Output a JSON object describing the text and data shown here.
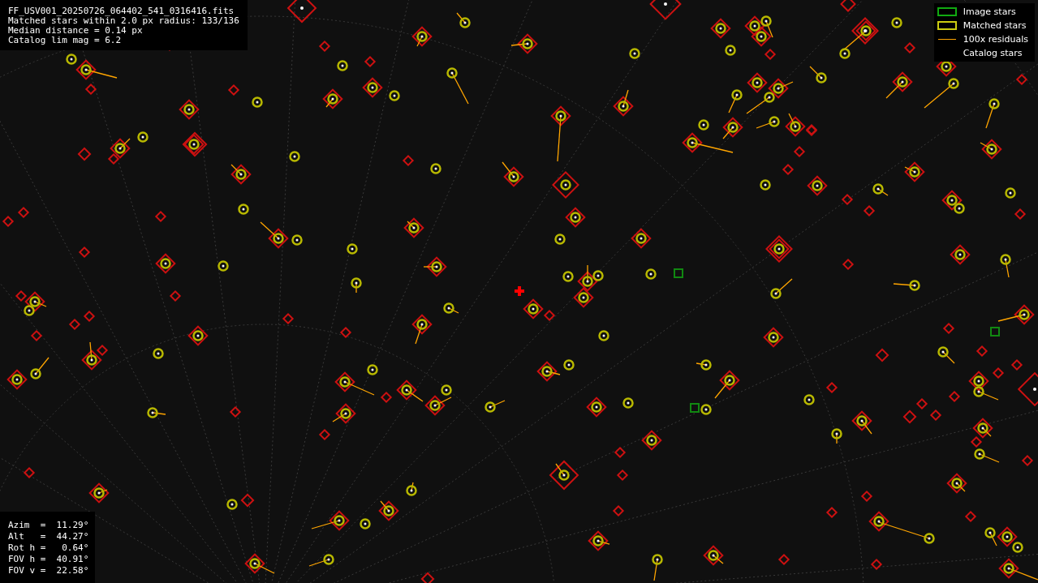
{
  "header": {
    "lines": [
      "FF_USV001_20250726_064402_541_0316416.fits",
      "Matched stars within 2.0 px radius: 133/136",
      "Median distance = 0.14 px",
      "Catalog lim mag = 6.2"
    ]
  },
  "legend": {
    "items": [
      {
        "kind": "box",
        "color": "#11aa11",
        "label": "Image stars"
      },
      {
        "kind": "box",
        "color": "#cccc11",
        "label": "Matched stars"
      },
      {
        "kind": "line",
        "color": "#ffa500",
        "label": "100x residuals"
      },
      {
        "kind": "blank",
        "label": "Catalog stars"
      }
    ]
  },
  "pointing": {
    "lines": [
      "Azim  =  11.29°",
      "Alt   =  44.27°",
      "Rot h =   0.64°",
      "FOV h =  40.91°",
      "FOV v =  22.58°"
    ]
  }
}
